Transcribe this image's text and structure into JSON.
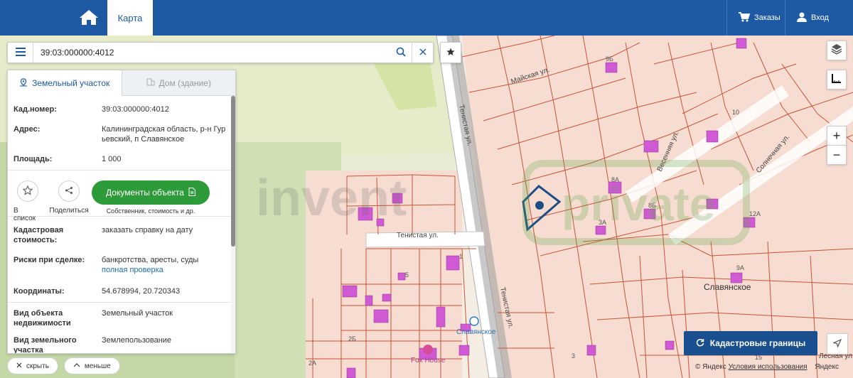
{
  "topbar": {
    "map_tab_label": "Карта",
    "orders_label": "Заказы",
    "login_label": "Вход"
  },
  "search": {
    "value": "39:03:000000:4012"
  },
  "panel": {
    "tab_land": "Земельный участок",
    "tab_house": "Дом (здание)",
    "cad_number_label": "Кад.номер:",
    "cad_number_value": "39:03:000000:4012",
    "address_label": "Адрес:",
    "address_value": "Калининградская область, р-н Гурьевский, п Славянское",
    "area_label": "Площадь:",
    "area_value": "1 000",
    "action_list": "В список",
    "action_share": "Поделиться",
    "docs_button": "Документы объекта",
    "docs_sub": "Собственник, стоимость и др.",
    "cad_cost_label": "Кадастровая стоимость:",
    "cad_cost_link": "заказать справку на дату",
    "risks_label": "Риски при сделке:",
    "risks_value": "банкротства, аресты, суды",
    "risks_link": "полная проверка",
    "coords_label": "Координаты:",
    "coords_value": "54.678994, 20.720343",
    "object_type_label": "Вид объекта недвижимости",
    "object_type_value": "Земельный участок",
    "land_type_label": "Вид земельного участка",
    "land_type_value": "Землепользование"
  },
  "bottom": {
    "hide_label": "скрыть",
    "less_label": "меньше"
  },
  "map": {
    "streets": {
      "maiskaya": "Майская ул.",
      "tenistaya_v1": "Тенистая ул.",
      "tenistaya_h": "Тенистая ул.",
      "tenistaya_v2": "Тенистая ул.",
      "vesennyaya": "Весенняя ул.",
      "solnechnaya": "Солнечная ул.",
      "lesnaya": "Лесная ул."
    },
    "place_name": "Славянское",
    "poi_slavyanskoe": "Славянское",
    "poi_foxhouse": "Fox House",
    "house_numbers": {
      "n9b": "9Б",
      "n10": "10",
      "n8a": "8А",
      "n8b": "8Б",
      "n12a": "12А",
      "n3a": "3А",
      "n9a": "9А",
      "n5": "5",
      "n1": "1",
      "n2b": "2Б",
      "n2a": "2А",
      "n3": "3",
      "n15": "15"
    },
    "watermark_left": "invent",
    "watermark_right": "private"
  },
  "controls": {
    "zoom_in": "+",
    "zoom_out": "−",
    "cadastral_button": "Кадастровые границы"
  },
  "copyright": {
    "prefix": "© Яндекс",
    "terms": "Условия использования",
    "brand": "Яндекс"
  },
  "colors": {
    "brand_blue": "#1d5aa3",
    "docs_green": "#2e9b3a",
    "parcel_line": "#c8553a",
    "parcel_fill": "#f4d9cf",
    "building": "#d05ad4",
    "selection": "#1d4e85"
  }
}
